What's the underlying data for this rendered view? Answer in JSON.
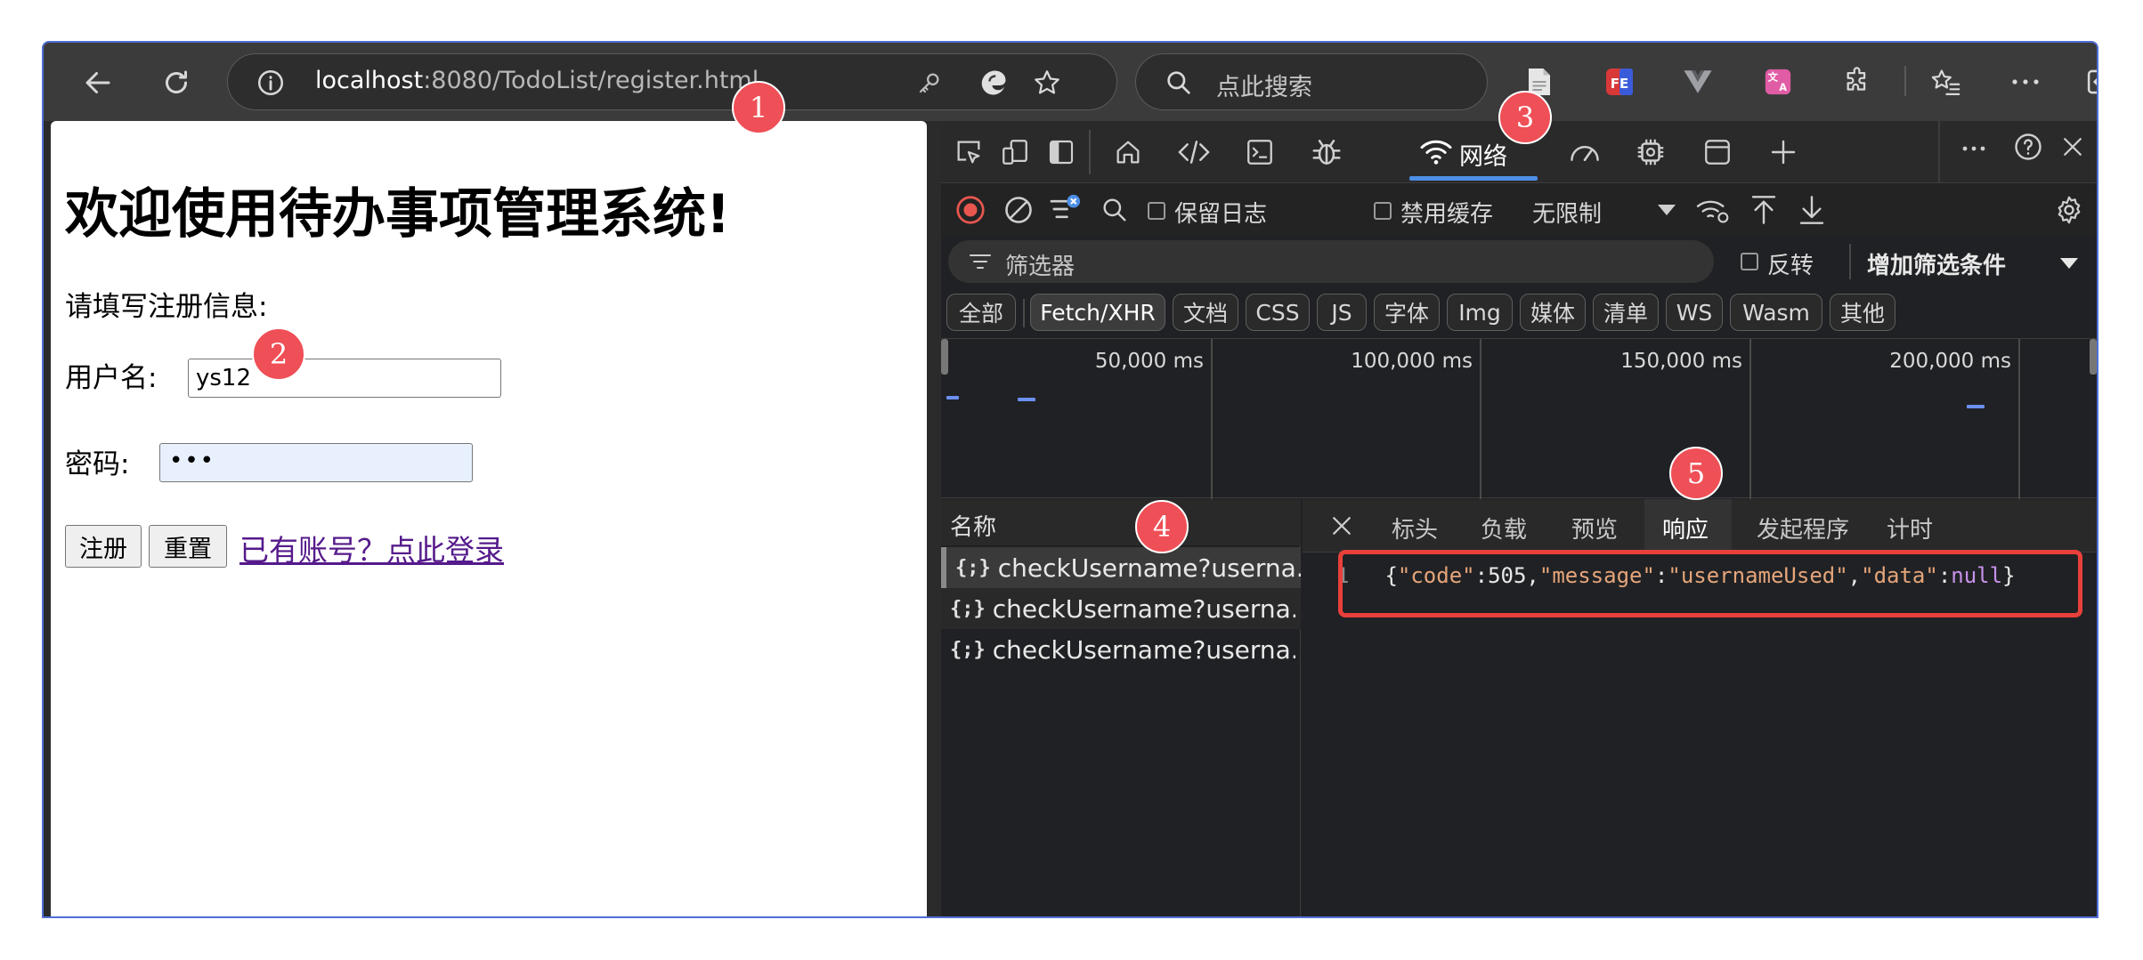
{
  "browser": {
    "url_host": "localhost",
    "url_path": ":8080/TodoList/register.html",
    "search_placeholder": "点此搜索"
  },
  "page": {
    "title": "欢迎使用待办事项管理系统!",
    "intro": "请填写注册信息:",
    "username_label": "用户名:",
    "username_value": "ys12",
    "password_label": "密码:",
    "password_value": "•••",
    "register_button": "注册",
    "reset_button": "重置",
    "login_link": "已有账号？点此登录"
  },
  "devtools": {
    "network_tab_label": "网络",
    "preserve_log_label": "保留日志",
    "disable_cache_label": "禁用缓存",
    "throttle_value": "无限制",
    "filter_placeholder": "筛选器",
    "invert_label": "反转",
    "add_filter_label": "增加筛选条件",
    "type_filters": [
      "全部",
      "Fetch/XHR",
      "文档",
      "CSS",
      "JS",
      "字体",
      "Img",
      "媒体",
      "清单",
      "WS",
      "Wasm",
      "其他"
    ],
    "active_type_filter": "Fetch/XHR",
    "overview_ticks": [
      "50,000 ms",
      "100,000 ms",
      "150,000 ms",
      "200,000 ms"
    ],
    "requests_header": "名称",
    "requests": [
      {
        "icon": "{;}",
        "name": "checkUsername?userna..."
      },
      {
        "icon": "{;}",
        "name": "checkUsername?userna..."
      },
      {
        "icon": "{;}",
        "name": "checkUsername?userna..."
      }
    ],
    "detail_tabs": [
      "标头",
      "负载",
      "预览",
      "响应",
      "发起程序",
      "计时"
    ],
    "active_detail_tab": "响应",
    "response": {
      "line_number": "1",
      "code_key": "\"code\"",
      "code_value": "505",
      "message_key": "\"message\"",
      "message_value": "\"usernameUsed\"",
      "data_key": "\"data\"",
      "data_value": "null"
    }
  },
  "annotations": [
    "1",
    "2",
    "3",
    "4",
    "5"
  ],
  "colors": {
    "badge": "#ef4f56",
    "highlight": "#e8403a",
    "window_border": "#4f6fd8",
    "link_visited": "#551a8b",
    "network_underline": "#4d8fe6",
    "json_key": "#e5a57a",
    "json_null": "#c792ea"
  }
}
